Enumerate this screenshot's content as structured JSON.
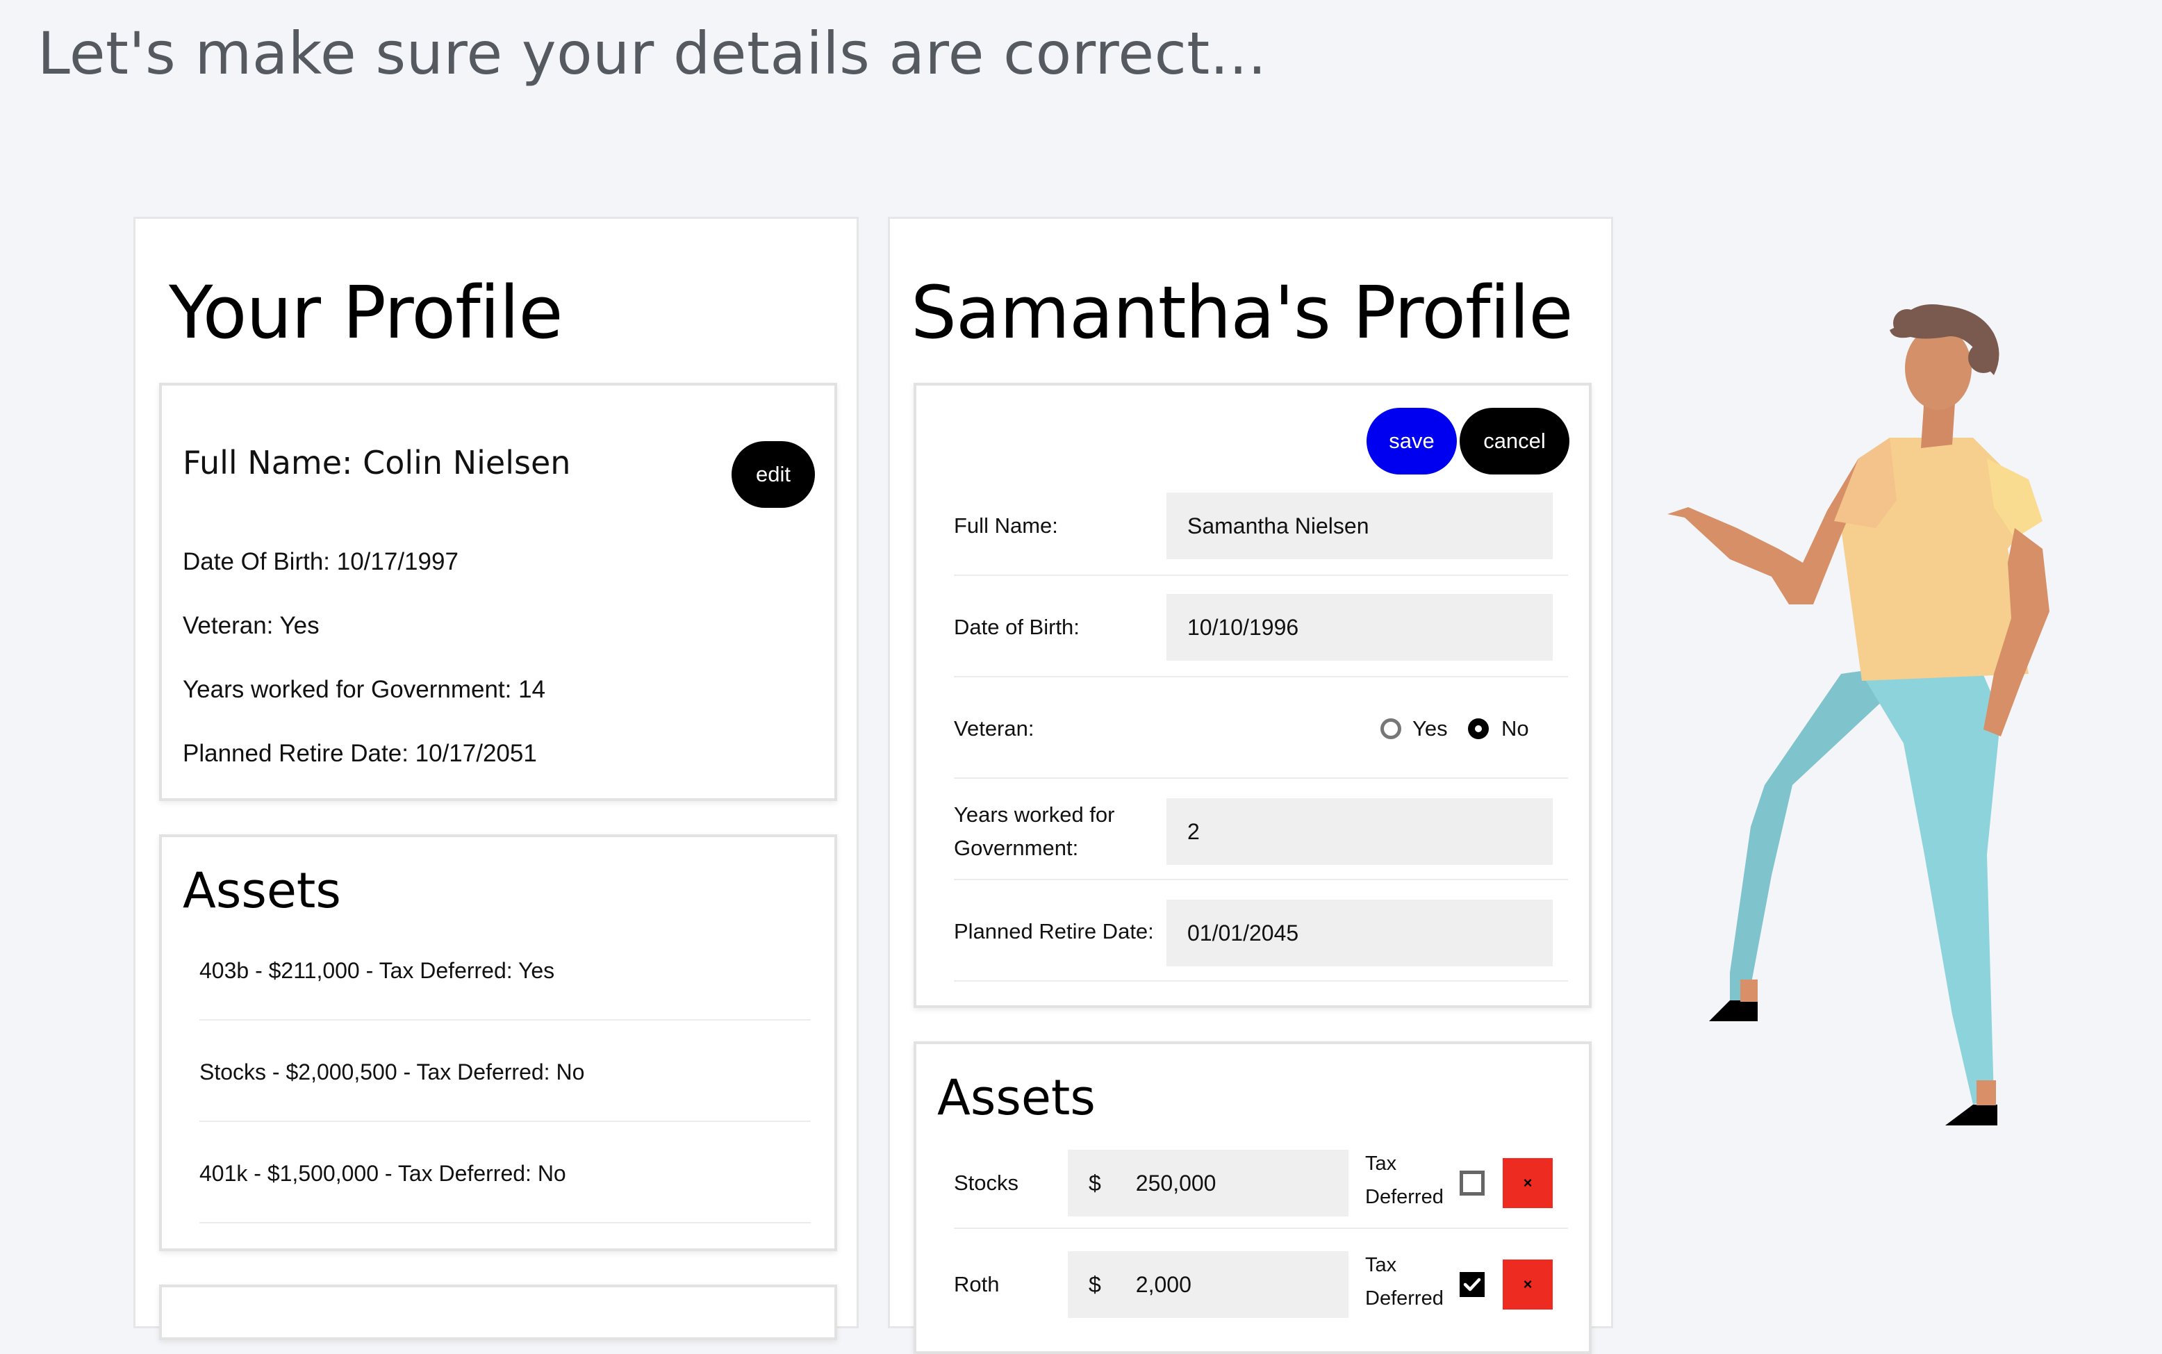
{
  "page": {
    "heading": "Let's make sure your details are correct..."
  },
  "colors": {
    "save_button": "#0000f0",
    "edit_button": "#000000",
    "delete_button": "#ee2b21",
    "background": "#f4f5f9"
  },
  "your_profile": {
    "title": "Your Profile",
    "full_name": "Full Name: Colin Nielsen",
    "edit_label": "edit",
    "date_of_birth": "Date Of Birth: 10/17/1997",
    "veteran": "Veteran: Yes",
    "years_worked": "Years worked for Government: 14",
    "retire_date": "Planned Retire Date: 10/17/2051",
    "assets_title": "Assets",
    "assets": [
      "403b - $211,000 - Tax Deferred: Yes",
      "Stocks - $2,000,500 - Tax Deferred: No",
      "401k - $1,500,000 - Tax Deferred: No"
    ]
  },
  "spouse_profile": {
    "title": "Samantha's Profile",
    "save_label": "save",
    "cancel_label": "cancel",
    "labels": {
      "full_name": "Full Name:",
      "date_of_birth": "Date of Birth:",
      "veteran": "Veteran:",
      "years_line1": "Years worked for",
      "years_line2": "Government:",
      "retire_date": "Planned Retire Date:"
    },
    "values": {
      "full_name": "Samantha Nielsen",
      "date_of_birth": "10/10/1996",
      "years_worked": "2",
      "retire_date": "01/01/2045"
    },
    "veteran_options": {
      "yes": "Yes",
      "no": "No",
      "selected": "No"
    },
    "assets_title": "Assets",
    "assets": [
      {
        "name": "Stocks",
        "currency": "$",
        "amount": "250,000",
        "tax_line1": "Tax",
        "tax_line2": "Deferred",
        "tax_deferred": false,
        "delete": "×"
      },
      {
        "name": "Roth",
        "currency": "$",
        "amount": "2,000",
        "tax_line1": "Tax",
        "tax_line2": "Deferred",
        "tax_deferred": true,
        "delete": "×"
      }
    ]
  },
  "illustration": {
    "icon": "person-pointing-illustration"
  }
}
